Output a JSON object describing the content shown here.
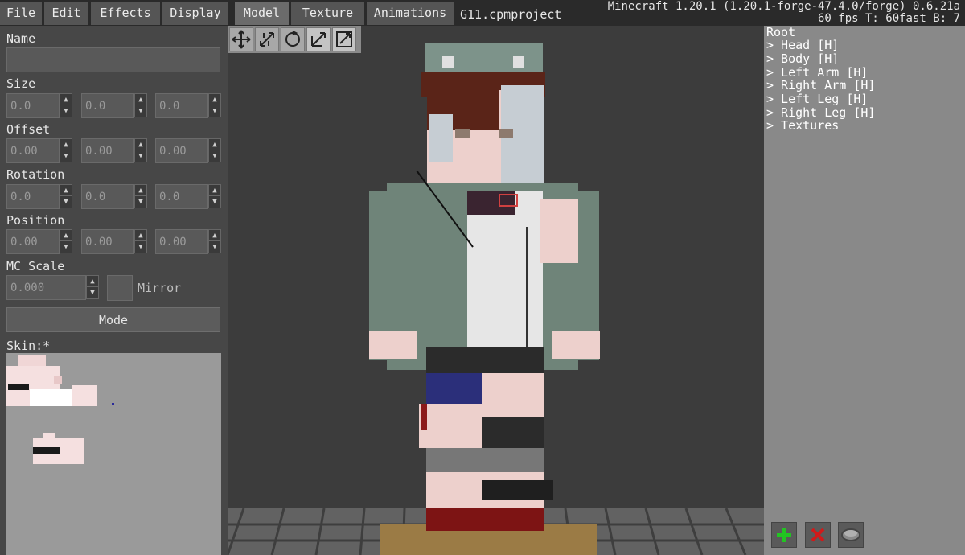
{
  "menu": {
    "file": "File",
    "edit": "Edit",
    "effects": "Effects",
    "display": "Display",
    "model": "Model",
    "texture": "Texture",
    "animations": "Animations"
  },
  "file_title": "G11.cpmproject",
  "mc_info": {
    "line1": "Minecraft 1.20.1 (1.20.1-forge-47.4.0/forge) 0.6.21a",
    "line2": "60 fps T: 60fast B: 7"
  },
  "left_panel": {
    "name_label": "Name",
    "name_value": "",
    "size_label": "Size",
    "size": [
      "0.0",
      "0.0",
      "0.0"
    ],
    "offset_label": "Offset",
    "offset": [
      "0.00",
      "0.00",
      "0.00"
    ],
    "rotation_label": "Rotation",
    "rotation": [
      "0.0",
      "0.0",
      "0.0"
    ],
    "position_label": "Position",
    "position": [
      "0.00",
      "0.00",
      "0.00"
    ],
    "mc_scale_label": "MC Scale",
    "mc_scale": "0.000",
    "mirror_label": "Mirror",
    "mode_label": "Mode",
    "skin_label": "Skin:*"
  },
  "tools": [
    "move-icon",
    "resize-icon",
    "rotate-icon",
    "scale-icon",
    "free-transform-icon"
  ],
  "tree": {
    "root": "Root",
    "items": [
      "> Head [H]",
      "> Body [H]",
      "> Left Arm [H]",
      "> Right Arm [H]",
      "> Left Leg [H]",
      "> Right Leg [H]",
      "> Textures"
    ]
  },
  "colors": {
    "panel": "#474747",
    "viewport": "#3c3c3c",
    "tree_panel": "#898989",
    "add": "#22c422",
    "delete": "#d01a1a"
  }
}
